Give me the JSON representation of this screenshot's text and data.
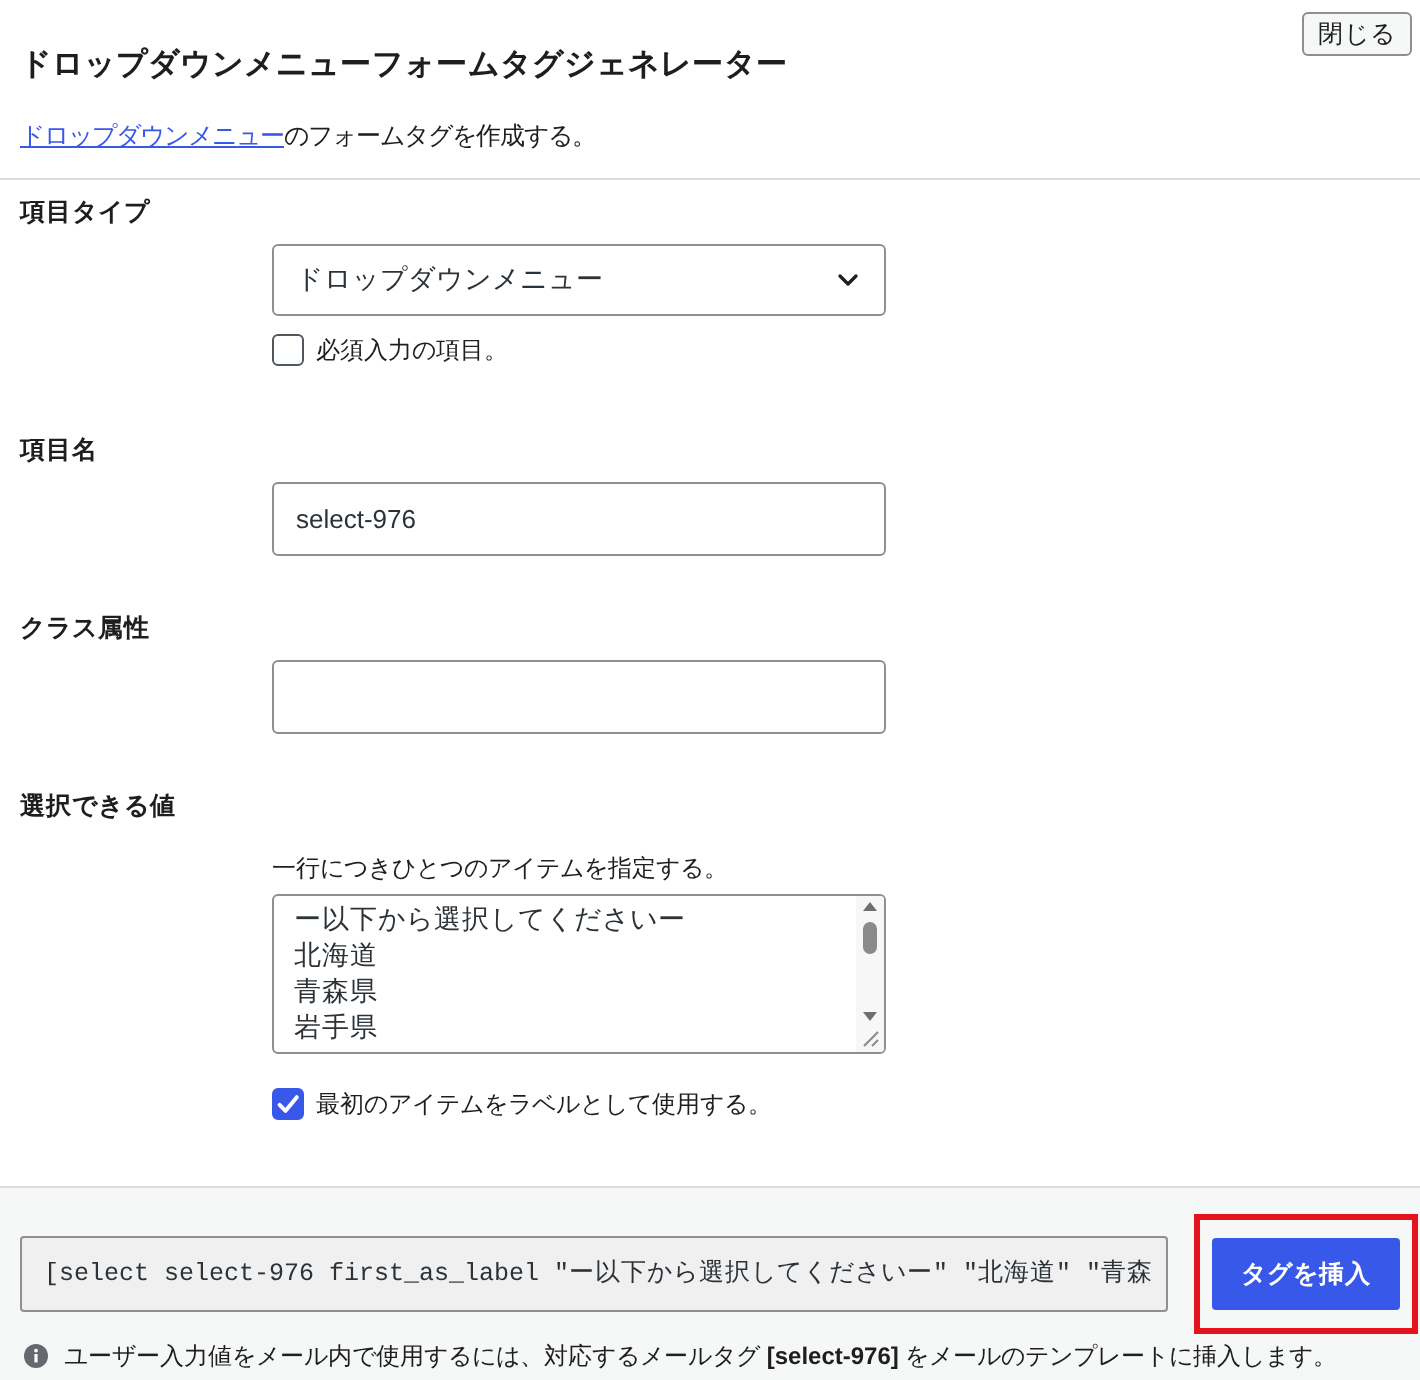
{
  "dialog": {
    "title": "ドロップダウンメニューフォームタグジェネレーター",
    "close_button": "閉じる",
    "description": {
      "link": "ドロップダウンメニュー",
      "text": "のフォームタグを作成する。"
    }
  },
  "fields": [
    {
      "kind": "select",
      "label": "項目タイプ",
      "value": "ドロップダウンメニュー",
      "checkbox": {
        "label": "必須入力の項目。",
        "checked": false
      }
    },
    {
      "kind": "text",
      "label": "項目名",
      "value": "select-976"
    },
    {
      "kind": "text",
      "label": "クラス属性"
    },
    {
      "kind": "textarea",
      "label": "選択できる値",
      "hint": "一行につきひとつのアイテムを指定する。",
      "lines": [
        "ー以下から選択してくださいー",
        "北海道",
        "青森県",
        "岩手県"
      ],
      "checkbox": {
        "label": "最初のアイテムをラベルとして使用する。",
        "checked": true
      }
    }
  ],
  "footer": {
    "tag_code": "[select select-976 first_as_label \"ー以下から選択してくださいー\" \"北海道\" \"青森",
    "insert_button": {
      "label": "タグを挿入",
      "highlighted": true
    },
    "note": "ユーザー入力値をメール内で使用するには、対応するメールタグ **[select-976]** をメールのテンプレートに挿入します。"
  }
}
